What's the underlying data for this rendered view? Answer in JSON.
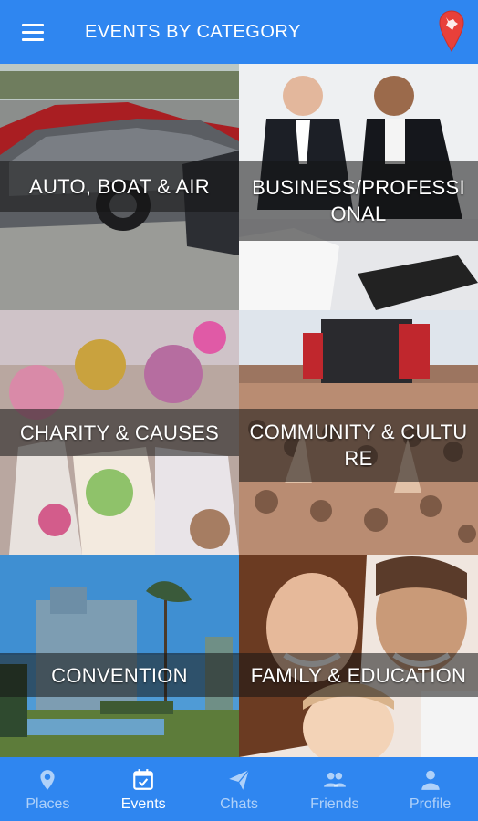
{
  "header": {
    "title": "EVENTS BY CATEGORY",
    "menu_icon": "hamburger-menu-icon",
    "location_icon": "state-map-pin-icon"
  },
  "categories": [
    {
      "label": "AUTO, BOAT & AIR"
    },
    {
      "label": "BUSINESS/PROFESSIONAL"
    },
    {
      "label": "CHARITY & CAUSES"
    },
    {
      "label": "COMMUNITY & CULTURE"
    },
    {
      "label": "CONVENTION"
    },
    {
      "label": "FAMILY & EDUCATION"
    }
  ],
  "nav": {
    "active": "Events",
    "items": [
      {
        "label": "Places",
        "icon": "map-pin-icon"
      },
      {
        "label": "Events",
        "icon": "calendar-icon"
      },
      {
        "label": "Chats",
        "icon": "paper-plane-icon"
      },
      {
        "label": "Friends",
        "icon": "people-icon"
      },
      {
        "label": "Profile",
        "icon": "person-icon"
      }
    ]
  },
  "colors": {
    "primary": "#2f86f0",
    "pin": "#e8403a",
    "band": "rgba(20,20,20,0.55)"
  }
}
